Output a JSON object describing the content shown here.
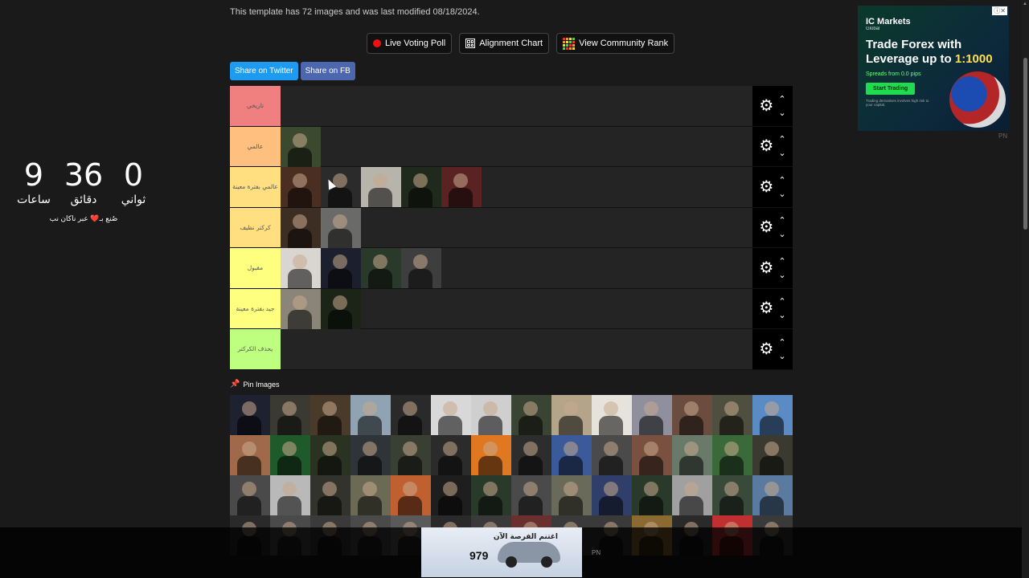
{
  "countdown": {
    "hours": "9",
    "hours_label": "ساعات",
    "minutes": "36",
    "minutes_label": "دقائق",
    "seconds": "0",
    "seconds_label": "ثواني",
    "credit": "صُنع بـ❤️ عبر ناكان نب"
  },
  "template_meta": "This template has 72 images and was last modified 08/18/2024.",
  "toolbar": {
    "live_voting": "Live Voting Poll",
    "alignment": "Alignment Chart",
    "community_rank": "View Community Rank"
  },
  "share": {
    "twitter": "Share on Twitter",
    "fb": "Share on FB"
  },
  "tiers": [
    {
      "label": "تاريخي",
      "color": "#f07f7f",
      "items": []
    },
    {
      "label": "عالمي",
      "color": "#ffbf7f",
      "items": [
        "#3b4a2e"
      ]
    },
    {
      "label": "عالمي بفترة معينة",
      "color": "#ffdf7f",
      "items": [
        "#4a2e22",
        "#2b2b2b",
        "#b7b4ab",
        "#1f2a1c",
        "#5a2222"
      ]
    },
    {
      "label": "كركتر نظيف",
      "color": "#ffdf7f",
      "items": [
        "#3d2e24",
        "#6a6a68"
      ]
    },
    {
      "label": "مقبول",
      "color": "#ffff7f",
      "items": [
        "#d9d5d0",
        "#1c1f2e",
        "#2a3a2a",
        "#3e3e3e"
      ]
    },
    {
      "label": "جيد بفترة معينة",
      "color": "#ffff7f",
      "items": [
        "#8a8578",
        "#1c2418"
      ]
    },
    {
      "label": "يحذف الكركتر",
      "color": "#bfff7f",
      "items": []
    }
  ],
  "pin_label": "Pin Images",
  "pool": [
    "#1d2130",
    "#3a3a33",
    "#4a3a2a",
    "#8fa3b2",
    "#2a2a2a",
    "#d8d8d8",
    "#cfcfcf",
    "#3a4433",
    "#b3a48a",
    "#e6e3dc",
    "#8f8f9e",
    "#6a4d3e",
    "#4f4f3f",
    "#5a8bc4",
    "#a06a4a",
    "#1f5a2a",
    "#2a3322",
    "#2f3438",
    "#3a3f33",
    "#2b2b2b",
    "#e07822",
    "#2d2d2d",
    "#3a5a9a",
    "#4a4a4a",
    "#7a5040",
    "#6a7a6a",
    "#3a6a3a",
    "#3a3a30",
    "#4a4a4a",
    "#b9b9b9",
    "#33332d",
    "#6a6a55",
    "#c06030",
    "#1e1e1e",
    "#2a3a2a",
    "#4a4a4a",
    "#6a6a5a",
    "#2f3f6a",
    "#2a3a2a",
    "#a0a0a0",
    "#3a4a3a",
    "#5a7aa0",
    "#2a2a2a",
    "#4a4a4a",
    "#3a3a3a",
    "#4a4a4a",
    "#5a5a5a",
    "#2a2a2a",
    "#3a3a3a",
    "#6a3030",
    "#3a3a3a",
    "#3a3a3a",
    "#8a6a30",
    "#2a2a2a",
    "#c03030",
    "#3a3a3a"
  ],
  "ad_right": {
    "brand": "IC Markets",
    "brand_sub": "Global",
    "headline": "Trade Forex with Leverage up to ",
    "highlight": "1:1000",
    "sub": "Spreads from 0.0 pips",
    "cta": "Start Trading",
    "disclaimer": "Trading derivatives involves high risk to your capital.",
    "pn": "PN"
  },
  "ad_bottom": {
    "headline": "اغتنم الفرصة الآن",
    "price": "979",
    "pn": "PN"
  }
}
